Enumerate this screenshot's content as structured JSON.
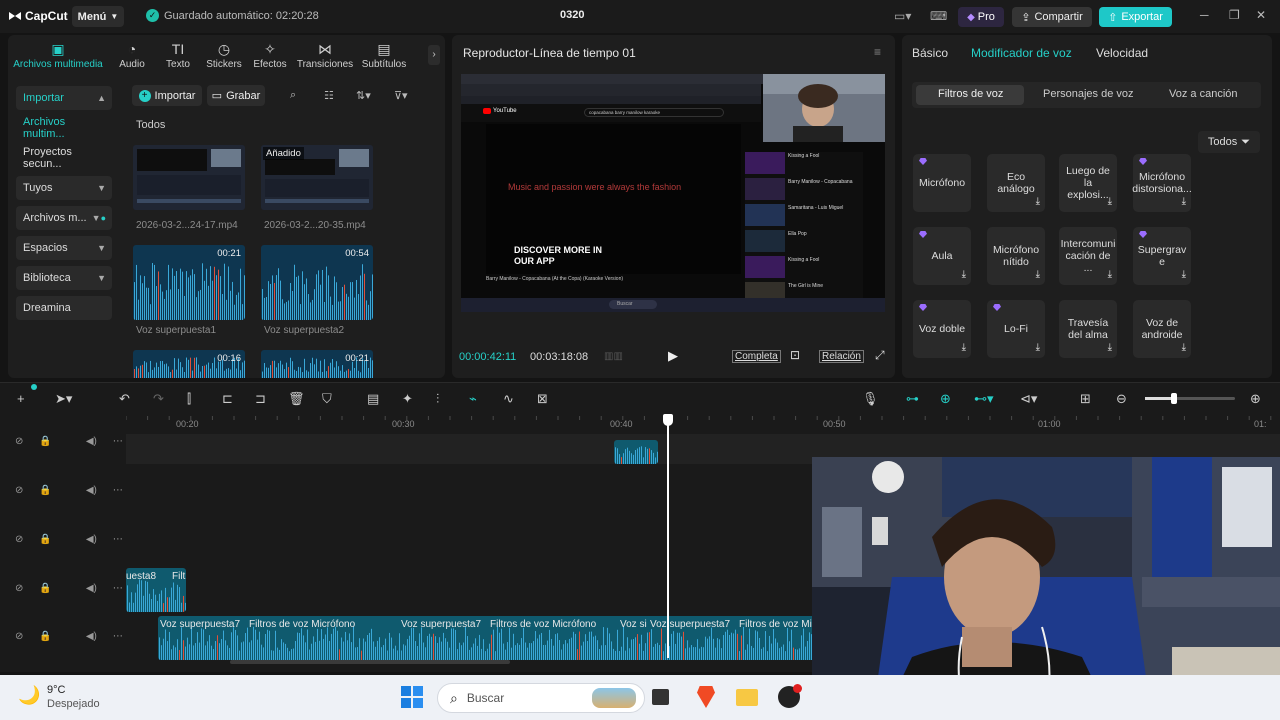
{
  "topbar": {
    "logo": "CapCut",
    "menu_label": "Menú",
    "autosave_text": "Guardado automático: 02:20:28",
    "project_name": "0320",
    "pro_label": "Pro",
    "share_label": "Compartir",
    "export_label": "Exportar"
  },
  "media_tabs": [
    {
      "label": "Archivos multimedia",
      "icon": "media-icon"
    },
    {
      "label": "Audio",
      "icon": "audio-icon"
    },
    {
      "label": "Texto",
      "icon": "text-icon"
    },
    {
      "label": "Stickers",
      "icon": "sticker-icon"
    },
    {
      "label": "Efectos",
      "icon": "effects-icon"
    },
    {
      "label": "Transiciones",
      "icon": "transitions-icon"
    },
    {
      "label": "Subtítulos",
      "icon": "subtitles-icon"
    }
  ],
  "sidebar": {
    "items": [
      {
        "label": "Importar"
      },
      {
        "label": "Archivos multim..."
      },
      {
        "label": "Proyectos secun..."
      },
      {
        "label": "Tuyos"
      },
      {
        "label": "Archivos m..."
      },
      {
        "label": "Espacios"
      },
      {
        "label": "Biblioteca"
      },
      {
        "label": "Dreamina"
      }
    ]
  },
  "media": {
    "import_label": "Importar",
    "record_label": "Grabar",
    "filter_label": "Todos",
    "added_badge": "Añadido",
    "files": [
      {
        "name": "2026-03-2...24-17.mp4"
      },
      {
        "name": "2026-03-2...20-35.mp4"
      },
      {
        "name": "Voz superpuesta1",
        "duration": "00:21"
      },
      {
        "name": "Voz superpuesta2",
        "duration": "00:54"
      },
      {
        "duration": "00:16"
      },
      {
        "duration": "00:21"
      }
    ]
  },
  "player": {
    "title": "Reproductor-Línea de tiempo 01",
    "current_time": "00:00:42:11",
    "total_time": "00:03:18:08",
    "complete_label": "Completa",
    "ratio_label": "Relación",
    "preview": {
      "lyric": "Music and passion were always the fashion",
      "promo": "DISCOVER MORE IN OUR APP",
      "video_title": "Barry Manilow - Copacabana (At the Copa) (Karaoke Version)",
      "yt_label": "YouTube",
      "search_text": "copacabana barry manilow karaoke",
      "side_videos": [
        "Kissing a Fool",
        "Barry Manilow - Copacabana",
        "Samaritana - Luis Miguel",
        "Ella Pop",
        "Kissing a Fool",
        "The Girl is Mine"
      ],
      "taskbar_search": "Buscar"
    }
  },
  "right_panel": {
    "tabs": [
      "Básico",
      "Modificador de voz",
      "Velocidad"
    ],
    "subtabs": [
      "Filtros de voz",
      "Personajes de voz",
      "Voz a canción"
    ],
    "filter_all": "Todos",
    "effects": [
      {
        "label": "Micrófono",
        "pro": true,
        "download": false
      },
      {
        "label": "Eco análogo",
        "pro": false,
        "download": true
      },
      {
        "label": "Luego de la explosi...",
        "pro": false,
        "download": true
      },
      {
        "label": "Micrófono distorsiona...",
        "pro": true,
        "download": true
      },
      {
        "label": "Aula",
        "pro": true,
        "download": true
      },
      {
        "label": "Micrófono nítido",
        "pro": false,
        "download": true
      },
      {
        "label": "Intercomuni cación de ...",
        "pro": false,
        "download": true
      },
      {
        "label": "Supergrav e",
        "pro": true,
        "download": true
      },
      {
        "label": "Voz doble",
        "pro": true,
        "download": true
      },
      {
        "label": "Lo-Fi",
        "pro": true,
        "download": true
      },
      {
        "label": "Travesía del alma",
        "pro": false,
        "download": true
      },
      {
        "label": "Voz de androide",
        "pro": false,
        "download": true
      }
    ]
  },
  "timeline": {
    "ruler": [
      "00:20",
      "00:30",
      "00:40",
      "00:50",
      "01:00",
      "01:"
    ],
    "clips_track4": [
      "uesta8",
      "Filtr"
    ],
    "clips_track5": [
      "Voz superpuesta7",
      "Filtros de voz Micrófono",
      "Voz superpuesta7",
      "Filtros de voz Micrófono",
      "Voz si",
      "Voz superpuesta7",
      "Filtros de voz Micrófono"
    ]
  },
  "taskbar": {
    "temperature": "9°C",
    "weather": "Despejado",
    "search_placeholder": "Buscar"
  },
  "colors": {
    "accent": "#26d0c8",
    "export": "#1ec8c8",
    "clip": "#0f5a6e",
    "pro_gem": "#9b6dff"
  }
}
